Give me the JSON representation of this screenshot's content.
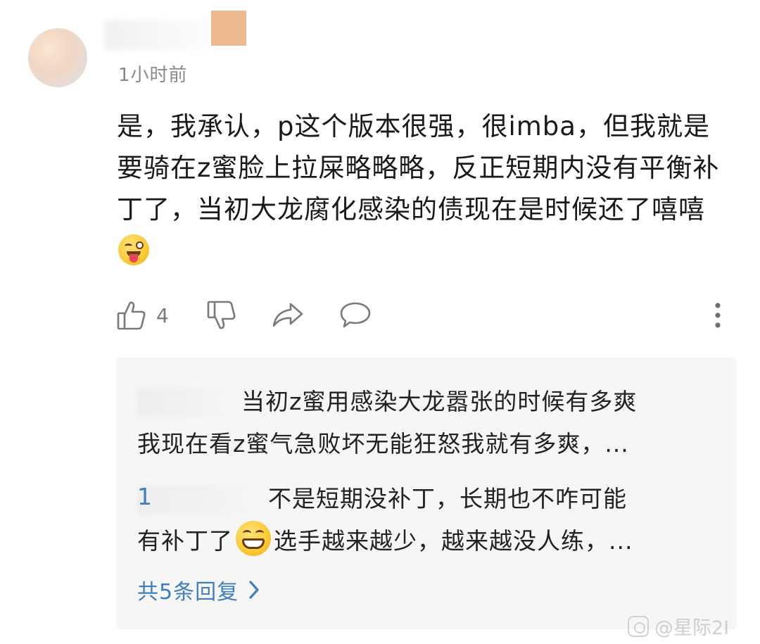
{
  "comment": {
    "timestamp": "1小时前",
    "text": "是，我承认，p这个版本很强，很imba，但我就是要骑在z蜜脸上拉屎略略略，反正短期内没有平衡补丁了，当初大龙腐化感染的债现在是时候还了嘻嘻",
    "trailing_emoji": "tongue-wink-emoji",
    "like_count": "4"
  },
  "replies": {
    "items": [
      {
        "line1": "当初z蜜用感染大龙嚣张的时候有多爽",
        "line2": "我现在看z蜜气急败坏无能狂怒我就有多爽，..."
      },
      {
        "name_fragment": "1",
        "line1": "不是短期没补丁，长期也不咋可能",
        "line2_before": "有补丁了",
        "emoji": "grinning-emoji",
        "line2_after": "选手越来越少，越来越没人练，..."
      }
    ],
    "total_label": "共5条回复"
  },
  "watermark": {
    "text": "@星际2I"
  },
  "colors": {
    "link": "#3f7fbf",
    "muted": "#8a8a8a",
    "reply_bg": "#f6f6f6"
  }
}
